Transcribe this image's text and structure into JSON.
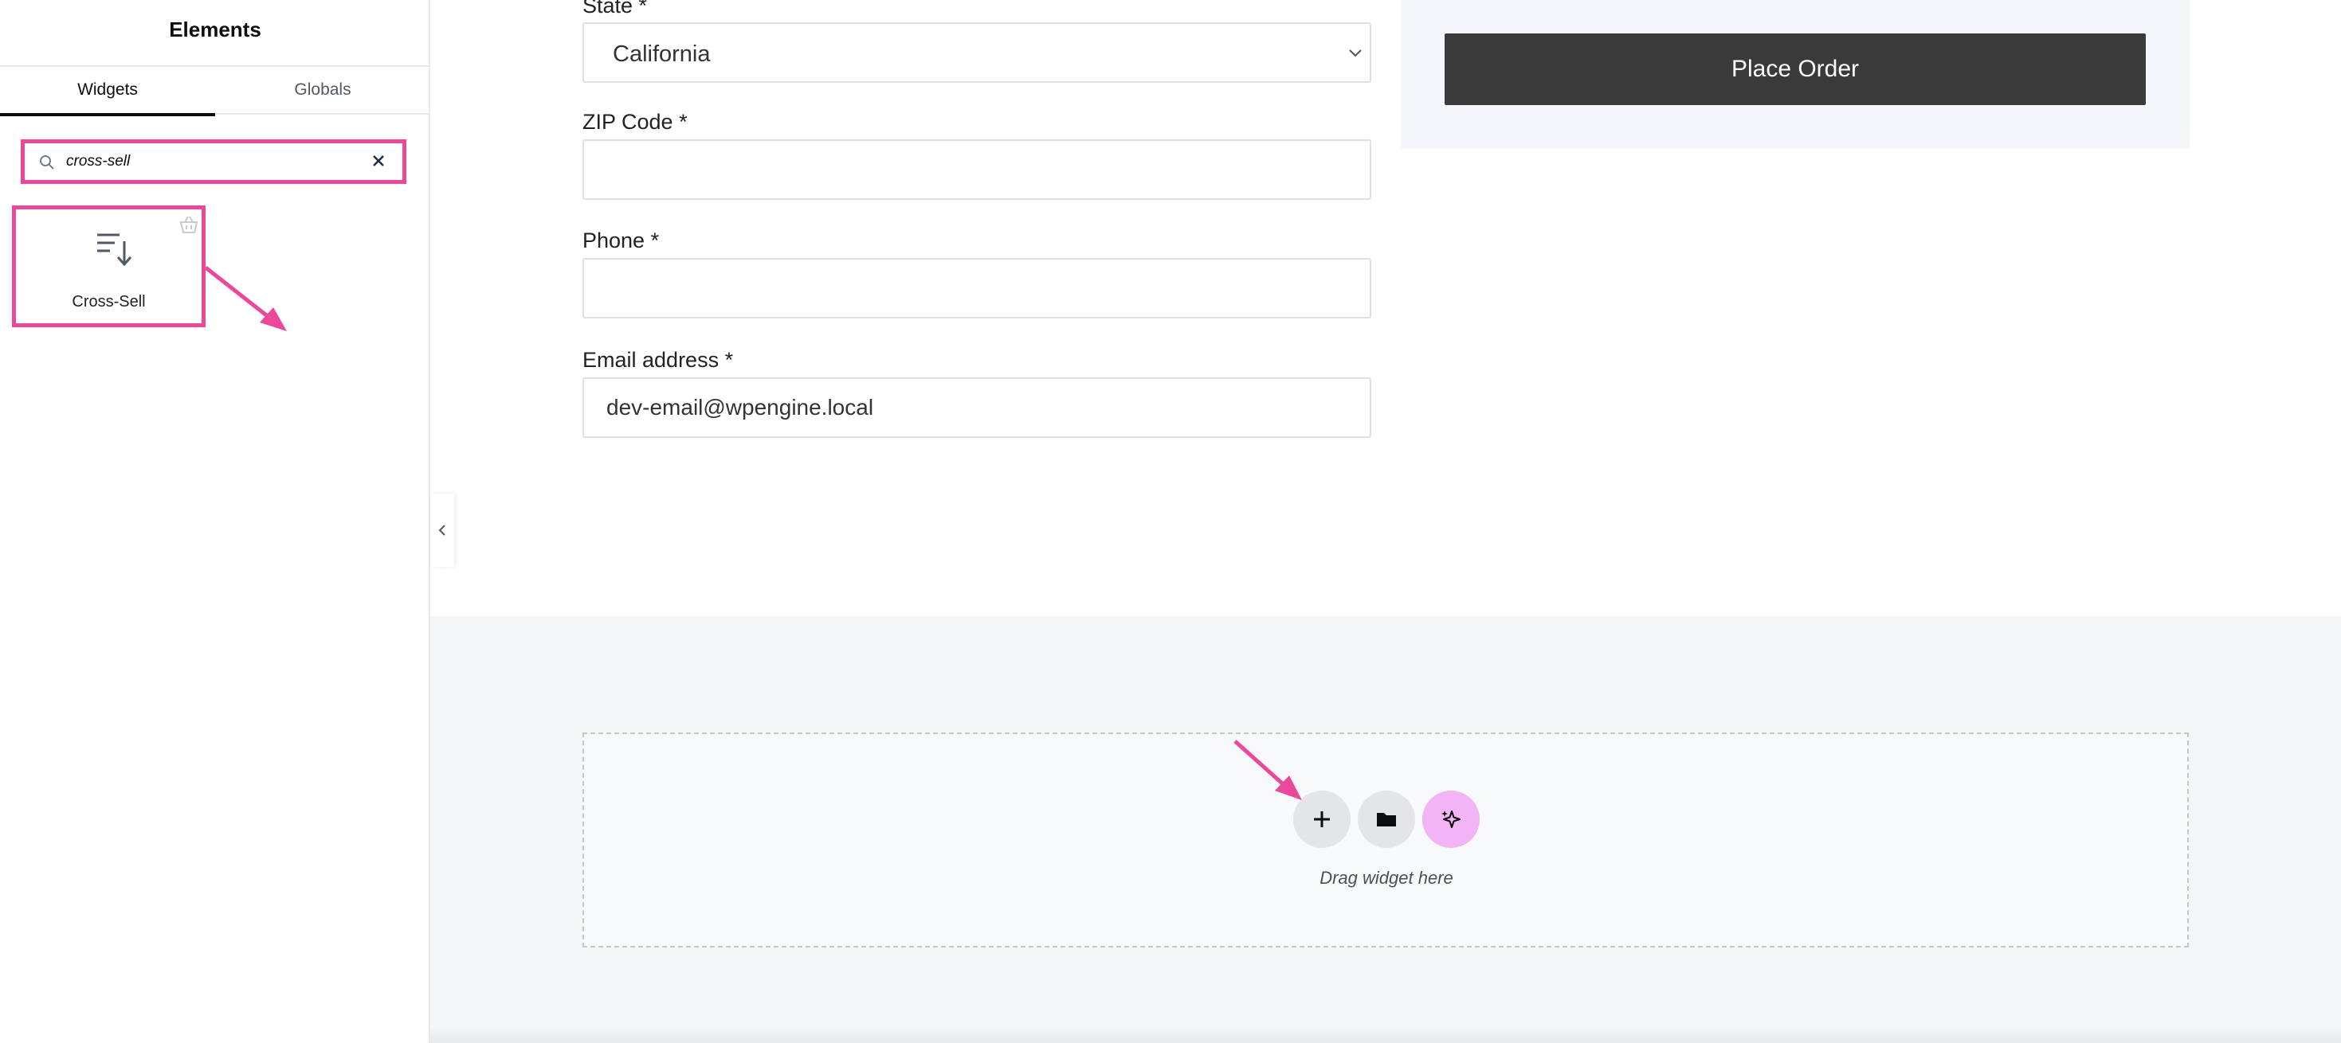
{
  "panel": {
    "title": "Elements",
    "tabs": [
      {
        "label": "Widgets",
        "active": true
      },
      {
        "label": "Globals",
        "active": false
      }
    ],
    "search": {
      "value": "cross-sell"
    },
    "results": [
      {
        "label": "Cross-Sell",
        "icon": "sort-list-icon",
        "pro_icon": "basket-icon"
      }
    ]
  },
  "form": {
    "state": {
      "label": "State *",
      "value": "California"
    },
    "zip": {
      "label": "ZIP Code *",
      "value": ""
    },
    "phone": {
      "label": "Phone *",
      "value": ""
    },
    "email": {
      "label": "Email address *",
      "value": "dev-email@wpengine.local"
    }
  },
  "order": {
    "place_order_label": "Place Order"
  },
  "dropzone": {
    "text": "Drag widget here",
    "buttons": [
      "add-icon",
      "folder-icon",
      "ai-sparkle-icon"
    ]
  },
  "colors": {
    "highlight": "#ec4899",
    "order_button": "#3a3a3a",
    "ai_button": "#f2b4f5"
  }
}
